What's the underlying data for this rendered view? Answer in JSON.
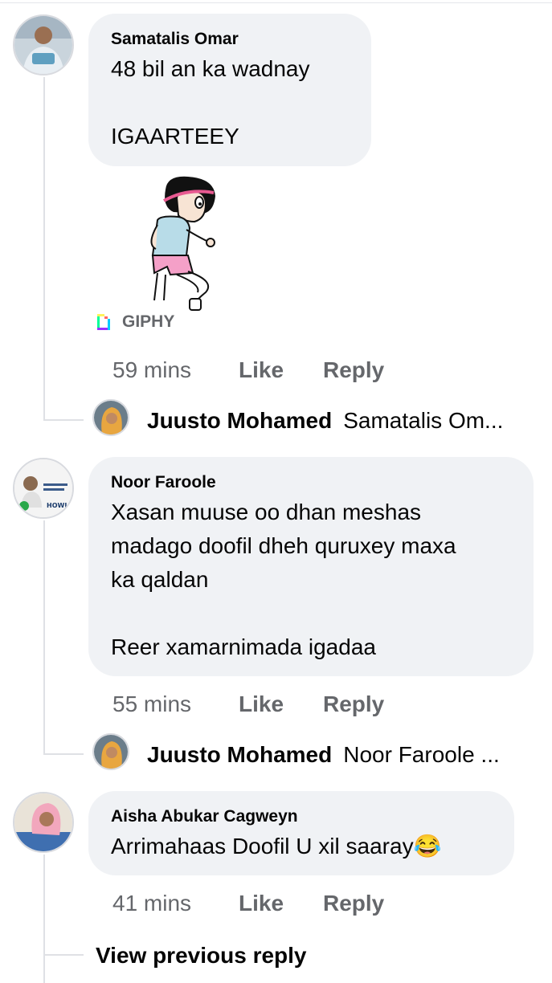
{
  "comments": [
    {
      "author": "Samatalis Omar",
      "text": "48 bil an ka wadnay\n\nIGAARTEEY",
      "attachment_label": "GIPHY",
      "time": "59 mins",
      "like_label": "Like",
      "reply_label": "Reply",
      "reply_preview": {
        "author": "Juusto Mohamed",
        "snippet": "Samatalis Om..."
      }
    },
    {
      "author": "Noor Faroole",
      "text": "Xasan muuse oo dhan meshas\nmadago doofil dheh quruxey maxa\nka qaldan\n\nReer xamarnimada igadaa",
      "avatar_text": "HOWLGALKA",
      "time": "55 mins",
      "like_label": "Like",
      "reply_label": "Reply",
      "reply_preview": {
        "author": "Juusto Mohamed",
        "snippet": "Noor Faroole ..."
      }
    },
    {
      "author": "Aisha Abukar Cagweyn",
      "text": "Arrimahaas Doofil U xil saaray😂",
      "time": "41 mins",
      "like_label": "Like",
      "reply_label": "Reply",
      "view_previous": "View previous reply"
    }
  ]
}
